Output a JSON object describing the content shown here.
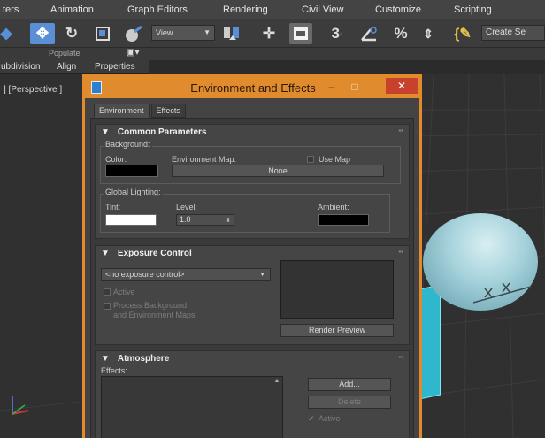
{
  "menu": {
    "items": [
      "ters",
      "Animation",
      "Graph Editors",
      "Rendering",
      "Civil View",
      "Customize",
      "Scripting"
    ]
  },
  "toolbar": {
    "view_dropdown": "View",
    "create_selection_set": "Create Se",
    "angle_snap_label": "3",
    "percent_snap_label": "%"
  },
  "ribbon": {
    "populate": "Populate",
    "subdivision": "ubdivision",
    "align": "Align",
    "properties": "Properties"
  },
  "viewport": {
    "label": "] [Perspective ]"
  },
  "dialog": {
    "title": "Environment and Effects",
    "minimize": "–",
    "maximize": "□",
    "close": "✕",
    "tabs": [
      "Environment",
      "Effects"
    ],
    "common_parameters": {
      "title": "Common Parameters",
      "background_group": "Background:",
      "color_label": "Color:",
      "environment_map_label": "Environment Map:",
      "use_map_label": "Use Map",
      "none_button": "None",
      "global_lighting_group": "Global Lighting:",
      "tint_label": "Tint:",
      "level_label": "Level:",
      "level_value": "1.0",
      "ambient_label": "Ambient:",
      "color_swatch": "#000000",
      "tint_swatch": "#ffffff",
      "ambient_swatch": "#000000"
    },
    "exposure_control": {
      "title": "Exposure Control",
      "dropdown_value": "<no exposure control>",
      "active_label": "Active",
      "process_background_label": "Process Background\nand Environment Maps",
      "process_line1": "Process Background",
      "process_line2": "and Environment Maps",
      "render_preview_button": "Render Preview"
    },
    "atmosphere": {
      "title": "Atmosphere",
      "effects_label": "Effects:",
      "add_button": "Add...",
      "delete_button": "Delete",
      "active_label": "Active"
    }
  },
  "colors": {
    "dialog_border": "#e28a2c",
    "close_button": "#c8412d",
    "selection_blue": "#5a8fd6",
    "sphere": "#a7d3dc",
    "box": "#2fb7cd"
  }
}
